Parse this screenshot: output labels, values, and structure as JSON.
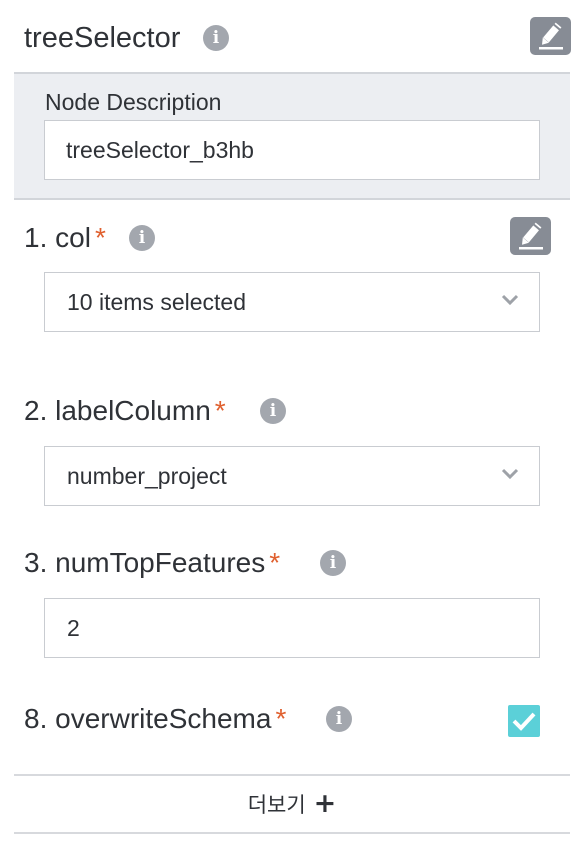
{
  "header": {
    "title": "treeSelector",
    "info_icon": "info-icon",
    "edit_icon": "edit-icon"
  },
  "node_description": {
    "label": "Node Description",
    "value": "treeSelector_b3hb"
  },
  "params": [
    {
      "label": "1. col",
      "required": "*",
      "value": "10 items selected",
      "type": "multi-select"
    },
    {
      "label": "2. labelColumn",
      "required": "*",
      "value": "number_project",
      "type": "select"
    },
    {
      "label": "3. numTopFeatures",
      "required": "*",
      "value": "2",
      "type": "number-input"
    },
    {
      "label": "8. overwriteSchema",
      "required": "*",
      "checked": true,
      "type": "checkbox"
    }
  ],
  "more": {
    "label": "더보기",
    "icon": "plus-icon"
  },
  "colors": {
    "accent_required": "#e0602f",
    "checkbox": "#5bd0d8",
    "edit_button": "#878c95",
    "info_icon": "#a3a7ae"
  }
}
